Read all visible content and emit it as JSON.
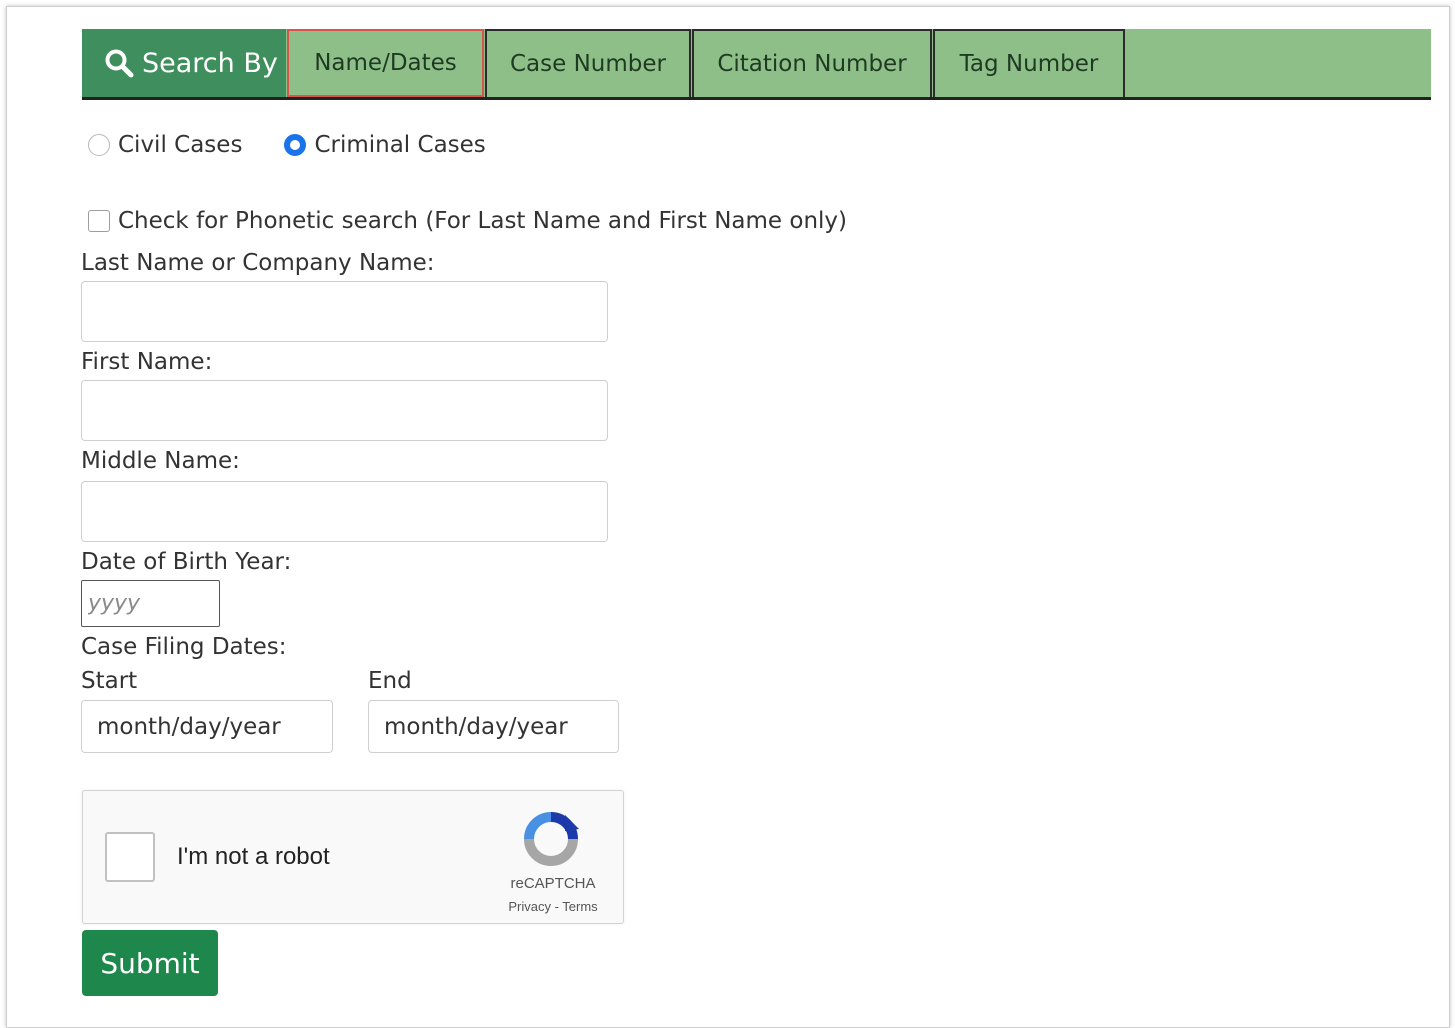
{
  "tabs": {
    "search_by_label": "Search By",
    "items": [
      {
        "label": "Name/Dates",
        "active": true
      },
      {
        "label": "Case Number",
        "active": false
      },
      {
        "label": "Citation Number",
        "active": false
      },
      {
        "label": "Tag Number",
        "active": false
      }
    ]
  },
  "case_type": {
    "civil_label": "Civil Cases",
    "criminal_label": "Criminal Cases",
    "selected": "Criminal Cases"
  },
  "phonetic": {
    "label": "Check for Phonetic search (For Last Name and First Name only)",
    "checked": false
  },
  "form": {
    "last_name_label": "Last Name or Company Name:",
    "last_name_value": "",
    "first_name_label": "First Name:",
    "first_name_value": "",
    "middle_name_label": "Middle Name:",
    "middle_name_value": "",
    "dob_label": "Date of Birth Year:",
    "dob_placeholder": "yyyy",
    "filing_dates_label": "Case Filing Dates:",
    "start_label": "Start",
    "start_placeholder": "month/day/year",
    "end_label": "End",
    "end_placeholder": "month/day/year"
  },
  "captcha": {
    "label": "I'm not a robot",
    "brand": "reCAPTCHA",
    "privacy": "Privacy",
    "separator": " - ",
    "terms": "Terms"
  },
  "submit_label": "Submit",
  "colors": {
    "tab_bar": "#8fbf88",
    "search_by_bg": "#3e8f5d",
    "active_tab_border": "#d9534f",
    "radio_checked": "#1a73e8",
    "submit_bg": "#1e874b"
  },
  "icons": {
    "search": "magnifier-icon",
    "captcha": "recaptcha-logo-icon"
  }
}
